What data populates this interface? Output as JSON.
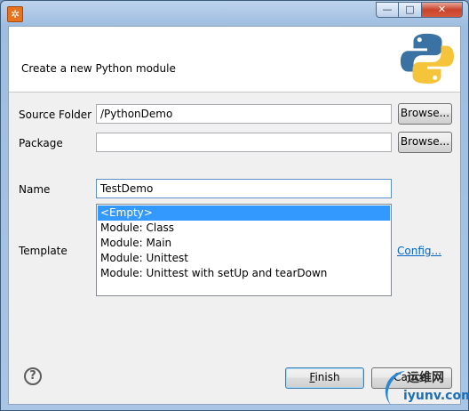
{
  "window": {
    "app_icon": "gear-icon",
    "controls": {
      "minimize": "—",
      "maximize": "□",
      "close": "✕"
    }
  },
  "banner": {
    "message": "Create a new Python module",
    "logo": "python-logo",
    "logo_colors": {
      "blue": "#3a72a4",
      "yellow": "#f6c43a"
    }
  },
  "form": {
    "source_folder": {
      "label": "Source Folder",
      "value": "/PythonDemo",
      "browse_label": "Browse..."
    },
    "package": {
      "label": "Package",
      "value": "",
      "browse_label": "Browse..."
    },
    "name": {
      "label": "Name",
      "value": "TestDemo"
    },
    "template": {
      "label": "Template",
      "items": [
        "<Empty>",
        "Module: Class",
        "Module: Main",
        "Module: Unittest",
        "Module: Unittest with setUp and tearDown"
      ],
      "selected_index": 0,
      "config_link": "Config..."
    }
  },
  "footer": {
    "help": "?",
    "finish_label": "Finish",
    "cancel_label": "Cancel"
  },
  "watermark": {
    "line1": "运维网",
    "line2": "iyunv.com"
  },
  "colors": {
    "selection": "#3399ff",
    "link": "#0066cc",
    "title_bar": "#a9c5e6"
  }
}
